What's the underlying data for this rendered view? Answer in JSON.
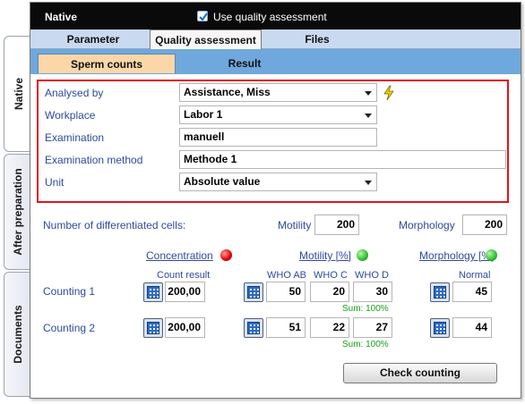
{
  "side_tabs": [
    {
      "label": "Native",
      "active": true
    },
    {
      "label": "After preparation",
      "active": false
    },
    {
      "label": "Documents",
      "active": false
    }
  ],
  "header": {
    "title": "Native",
    "use_quality_label": "Use quality assessment",
    "use_quality_checked": true
  },
  "tabs": [
    {
      "label": "Parameter",
      "active": false
    },
    {
      "label": "Quality assessment",
      "active": true
    },
    {
      "label": "Files",
      "active": false
    }
  ],
  "subtabs": [
    {
      "label": "Sperm counts",
      "active": true
    },
    {
      "label": "Result",
      "active": false
    }
  ],
  "form": {
    "analysed_by": {
      "label": "Analysed by",
      "value": "Assistance, Miss"
    },
    "workplace": {
      "label": "Workplace",
      "value": "Labor 1"
    },
    "examination": {
      "label": "Examination",
      "value": "manuell"
    },
    "examination_method": {
      "label": "Examination method",
      "value": "Methode 1"
    },
    "unit": {
      "label": "Unit",
      "value": "Absolute value"
    }
  },
  "differentiated": {
    "label": "Number of differentiated cells:",
    "motility_label": "Motility",
    "motility_value": "200",
    "morphology_label": "Morphology",
    "morphology_value": "200"
  },
  "columns": {
    "concentration": "Concentration",
    "motility": "Motility [%]",
    "morphology": "Morphology [%]",
    "count_result": "Count result",
    "who_ab": "WHO AB",
    "who_c": "WHO C",
    "who_d": "WHO  D",
    "normal": "Normal"
  },
  "status_colors": {
    "concentration": "#e00000",
    "motility": "#2fbf2f",
    "morphology": "#2fbf2f"
  },
  "counting": [
    {
      "label": "Counting 1",
      "count_result": "200,00",
      "who_ab": "50",
      "who_c": "20",
      "who_d": "30",
      "sum": "Sum: 100%",
      "normal": "45"
    },
    {
      "label": "Counting 2",
      "count_result": "200,00",
      "who_ab": "51",
      "who_c": "22",
      "who_d": "27",
      "sum": "Sum: 100%",
      "normal": "44"
    }
  ],
  "check_button": "Check counting",
  "icons": {
    "analysed_by_action": "lightning-icon",
    "calculator": "calculator-icon"
  }
}
